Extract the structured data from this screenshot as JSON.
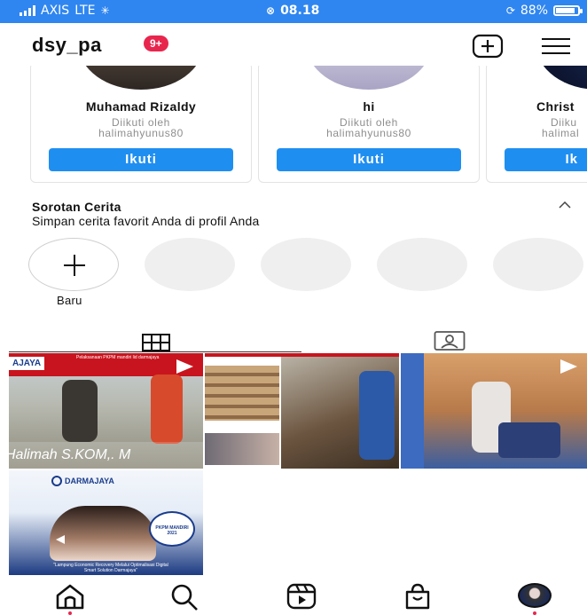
{
  "status_bar": {
    "carrier": "AXIS",
    "network": "LTE",
    "time": "08.18",
    "battery": "88%",
    "battery_level": 0.88
  },
  "header": {
    "username": "dsy_pa",
    "notification_badge": "9+"
  },
  "suggested_accounts": [
    {
      "name": "Muhamad Rizaldy",
      "followed_by_label": "Diikuti oleh",
      "followed_by": "halimahyunus80",
      "button": "Ikuti"
    },
    {
      "name": "hi",
      "followed_by_label": "Diikuti oleh",
      "followed_by": "halimahyunus80",
      "button": "Ikuti"
    },
    {
      "name": "Christ",
      "followed_by_label": "Diiku",
      "followed_by": "halimal",
      "button": "Ik"
    }
  ],
  "highlights": {
    "title": "Sorotan Cerita",
    "subtitle": "Simpan cerita favorit Anda di profil Anda",
    "new_label": "Baru"
  },
  "posts": [
    {
      "banner_text": "AJAYA",
      "caption_text": "Halimah S.KOM,. M",
      "header_text": "Pelaksanaan PKPM mandiri lid darmajaya"
    },
    {
      "header_text": ""
    },
    {
      "header_text": ""
    },
    {
      "brand": "DARMAJAYA",
      "badge": "PKPM MANDIRI 2021",
      "caption_text": "\"Lampung Economic Recovery Melalui Optimalisasi Digital Smart Solution Darmajaya\""
    }
  ],
  "colors": {
    "accent": "#2f86f0",
    "button": "#1f8ef1",
    "badge": "#e8264d"
  }
}
